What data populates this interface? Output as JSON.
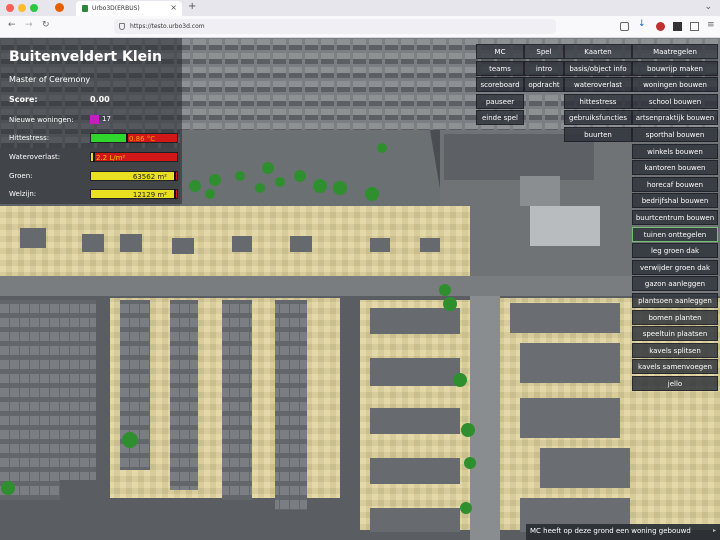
{
  "browser": {
    "tab_title": "Urbo3D(ERBUS)",
    "url": "https://testo.urbo3d.com",
    "colors": {
      "close": "#ff5f57",
      "minimize": "#febc2e",
      "zoom": "#28c840"
    }
  },
  "hud": {
    "title": "Buitenveldert Klein",
    "role": "Master of Ceremony",
    "score_label": "Score:",
    "score_value": "0.00",
    "woningen_label": "Nieuwe woningen:",
    "woningen_value": "17",
    "hittestress_label": "Hittestress:",
    "hittestress_value": "0.86 °C",
    "hittestress_fraction": 0.42,
    "wateroverlast_label": "Wateroverlast:",
    "wateroverlast_value": "2.2 L/m²",
    "wateroverlast_fraction": 0.04,
    "groen_label": "Groen:",
    "groen_value": "63562 m²",
    "groen_fraction": 0.98,
    "welzijn_label": "Welzijn:",
    "welzijn_value": "12129 m²",
    "welzijn_fraction": 0.98
  },
  "menus": {
    "mc": {
      "header": "MC",
      "items": [
        "teams",
        "scoreboard",
        "pauseer",
        "einde spel"
      ]
    },
    "spel": {
      "header": "Spel",
      "items": [
        "intro",
        "opdracht"
      ]
    },
    "kaarten": {
      "header": "Kaarten",
      "items": [
        "basis/object info",
        "wateroverlast",
        "hittestress",
        "gebruiksfuncties",
        "buurten"
      ]
    },
    "maatregelen": {
      "header": "Maatregelen",
      "active": "tuinen onttegelen",
      "items": [
        "bouwrijp maken",
        "woningen bouwen",
        "school bouwen",
        "artsenpraktijk bouwen",
        "sporthal bouwen",
        "winkels bouwen",
        "kantoren bouwen",
        "horecaf bouwen",
        "bedrijfshal bouwen",
        "buurtcentrum bouwen",
        "tuinen onttegelen",
        "leg groen dak",
        "verwijder groen dak",
        "gazon aanleggen",
        "plantsoen aanleggen",
        "bomen planten",
        "speeltuin plaatsen",
        "kavels splitsen",
        "kavels samenvoegen",
        "jello"
      ]
    }
  },
  "status": {
    "message": "MC heeft op deze grond een woning gebouwd"
  }
}
